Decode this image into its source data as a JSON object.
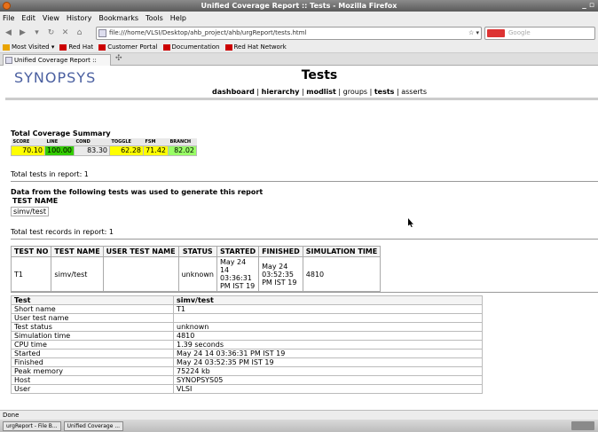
{
  "window": {
    "title": "Unified Coverage Report :: Tests - Mozilla Firefox"
  },
  "menu": [
    "File",
    "Edit",
    "View",
    "History",
    "Bookmarks",
    "Tools",
    "Help"
  ],
  "url": "file:///home/VLSI/Desktop/ahb_project/ahb/urgReport/tests.html",
  "search_placeholder": "Google",
  "bookmarks": [
    "Most Visited",
    "Red Hat",
    "Customer Portal",
    "Documentation",
    "Red Hat Network"
  ],
  "tab_label": "Unified Coverage Report :: Tests",
  "page": {
    "logo": "SYNOPSYS",
    "title": "Tests",
    "nav": {
      "dashboard": "dashboard",
      "hierarchy": "hierarchy",
      "modlist": "modlist",
      "groups": "groups",
      "tests": "tests",
      "asserts": "asserts"
    }
  },
  "summary": {
    "heading": "Total Coverage Summary",
    "headers": [
      "SCORE",
      "LINE",
      "COND",
      "TOGGLE",
      "FSM",
      "BRANCH"
    ],
    "values": [
      "70.10",
      "100.00",
      "83.30",
      "62.28",
      "71.42",
      "82.02"
    ],
    "colors": [
      "#ffff00",
      "#33cc00",
      "#eaeaea",
      "#ffff00",
      "#ffff00",
      "#99ff66"
    ]
  },
  "total_tests": "Total tests in report: 1",
  "data_from": "Data from the following tests was used to generate this report",
  "test_name_header": "TEST NAME",
  "test_name_value": "simv/test",
  "total_records": "Total test records in report: 1",
  "tests_table": {
    "headers": [
      "TEST NO",
      "TEST NAME",
      "USER TEST NAME",
      "STATUS",
      "STARTED",
      "FINISHED",
      "SIMULATION TIME"
    ],
    "row": [
      "T1",
      "simv/test",
      "",
      "unknown",
      "May 24 14 03:36:31 PM IST 19",
      "May 24 03:52:35 PM IST 19",
      "4810"
    ]
  },
  "details": {
    "header": [
      "Test",
      "simv/test"
    ],
    "rows": [
      [
        "Short name",
        "T1"
      ],
      [
        "User test name",
        ""
      ],
      [
        "Test status",
        "unknown"
      ],
      [
        "Simulation time",
        "4810"
      ],
      [
        "CPU time",
        "1.39 seconds"
      ],
      [
        "Started",
        "May 24 14 03:36:31 PM IST 19"
      ],
      [
        "Finished",
        "May 24 03:52:35 PM IST 19"
      ],
      [
        "Peak memory",
        "75224 kb"
      ],
      [
        "Host",
        "SYNOPSYS05"
      ],
      [
        "User",
        "VLSI"
      ]
    ]
  },
  "status": "Done",
  "taskbar": [
    "urgReport - File B...",
    "Unified Coverage ..."
  ]
}
